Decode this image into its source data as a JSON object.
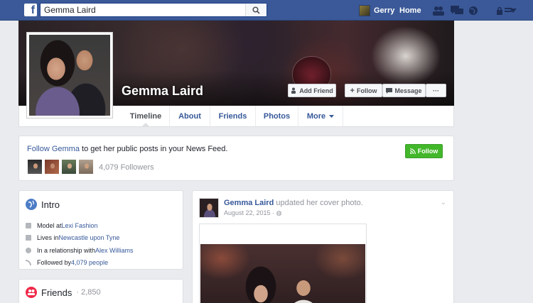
{
  "topbar": {
    "search_value": "Gemma Laird",
    "user_name": "Gerry",
    "home_label": "Home"
  },
  "profile": {
    "name": "Gemma Laird",
    "buttons": {
      "add_friend": "Add Friend",
      "follow": "Follow",
      "message": "Message",
      "more": "···"
    },
    "tabs": [
      "Timeline",
      "About",
      "Friends",
      "Photos",
      "More"
    ]
  },
  "follow_card": {
    "link_text": "Follow Gemma",
    "rest_text": " to get her public posts in your News Feed.",
    "button_label": "Follow",
    "followers_text": "4,079 Followers"
  },
  "intro": {
    "title": "Intro",
    "items": [
      {
        "prefix": "Model at ",
        "link": "Lexi Fashion",
        "suffix": ""
      },
      {
        "prefix": "Lives in ",
        "link": "Newcastle upon Tyne",
        "suffix": ""
      },
      {
        "prefix": "In a relationship with ",
        "link": "Alex Williams",
        "suffix": ""
      },
      {
        "prefix": "Followed by ",
        "link": "4,079 people",
        "suffix": ""
      }
    ]
  },
  "friends": {
    "title": "Friends",
    "count": "· 2,850"
  },
  "post": {
    "author": "Gemma Laird",
    "action": " updated her cover photo.",
    "date": "August 22, 2015 · "
  },
  "colors": {
    "topbar": "#3b5998",
    "link": "#365899",
    "follow_green": "#42b72a",
    "intro_globe": "#4c7cc6",
    "friends_icon": "#f02849"
  }
}
